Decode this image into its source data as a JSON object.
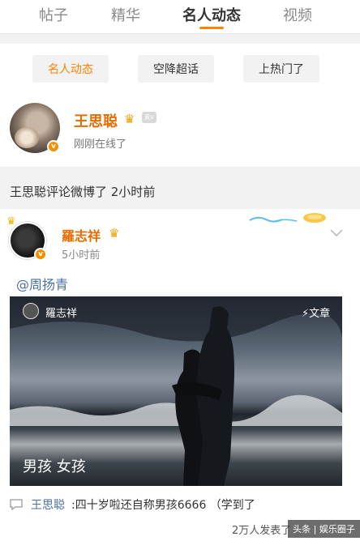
{
  "tabs": [
    {
      "label": "帖子"
    },
    {
      "label": "精华"
    },
    {
      "label": "名人动态"
    },
    {
      "label": "视频"
    }
  ],
  "filters": [
    {
      "label": "名人动态"
    },
    {
      "label": "空降超话"
    },
    {
      "label": "上热门了"
    }
  ],
  "celebrity": {
    "name": "王思聪",
    "status": "刚刚在线了",
    "level_badge": "黄V"
  },
  "comment_summary": "王思聪评论微博了 2小时前",
  "post": {
    "author": "羅志祥",
    "time": "5小时前",
    "mention": "@周扬青",
    "photo": {
      "author": "羅志祥",
      "tag": "⚡文章",
      "caption": "男孩 女孩"
    },
    "reply": {
      "author": "王思聪",
      "text": ":四十岁啦还自称男孩6666 （学到了"
    },
    "footer_count": "2万人发表了",
    "watermark": "头条 | 娱乐圈子"
  },
  "colors": {
    "accent": "#ff8200",
    "name": "#e86c00",
    "link": "#4a6fa5"
  }
}
